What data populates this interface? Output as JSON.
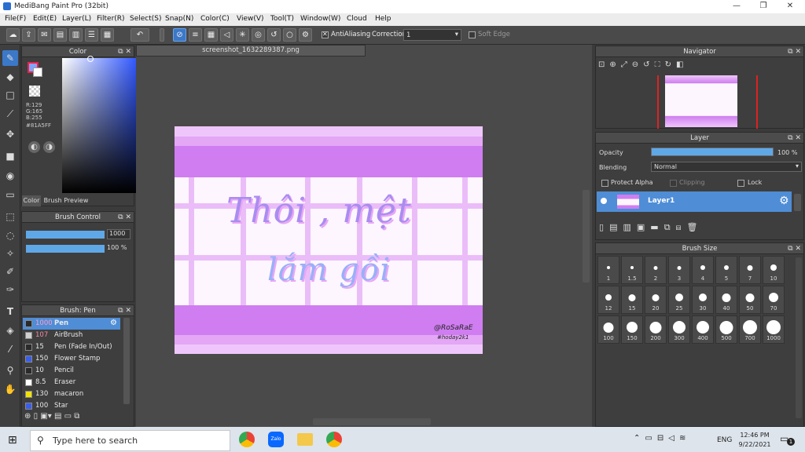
{
  "window": {
    "title": "MediBang Paint Pro (32bit)",
    "minimize": "—",
    "maximize": "❐",
    "close": "✕"
  },
  "menu": [
    "File(F)",
    "Edit(E)",
    "Layer(L)",
    "Filter(R)",
    "Select(S)",
    "Snap(N)",
    "Color(C)",
    "View(V)",
    "Tool(T)",
    "Window(W)",
    "Cloud",
    "Help"
  ],
  "toolbar": {
    "antialiasing_label": "AntiAliasing",
    "correction_label": "Correction",
    "correction_value": "1",
    "soft_edge_label": "Soft Edge"
  },
  "color_panel": {
    "title": "Color",
    "r": "R:129",
    "g": "G:165",
    "b": "B:255",
    "hex": "#81A5FF",
    "tab_color": "Color",
    "tab_brush_preview": "Brush Preview",
    "primary_color": "#81A5FF"
  },
  "brush_control": {
    "title": "Brush Control",
    "size_value": "1000",
    "opacity_value": "100 %"
  },
  "brush_panel": {
    "title": "Brush: Pen",
    "items": [
      {
        "size": "1000",
        "name": "Pen",
        "color": "#2a2a2a",
        "selected": true
      },
      {
        "size": "107",
        "name": "AirBrush",
        "color": "#cfcfcf"
      },
      {
        "size": "15",
        "name": "Pen (Fade In/Out)",
        "color": "#2a2a2a"
      },
      {
        "size": "150",
        "name": "Flower Stamp",
        "color": "#3a5ee8"
      },
      {
        "size": "10",
        "name": "Pencil",
        "color": "#2a2a2a"
      },
      {
        "size": "8.5",
        "name": "Eraser",
        "color": "#ffffff"
      },
      {
        "size": "130",
        "name": "macaron",
        "color": "#f2e200"
      },
      {
        "size": "100",
        "name": "Star",
        "color": "#3a5ee8"
      }
    ]
  },
  "document": {
    "tab": "screenshot_1632289387.png",
    "artwork_line1": "Thôi , mệt",
    "artwork_line2": "lắm gồi",
    "signature": "@RoSaRaE",
    "signature_tag": "#hoday2k1"
  },
  "navigator": {
    "title": "Navigator"
  },
  "layer_panel": {
    "title": "Layer",
    "opacity_label": "Opacity",
    "opacity_value": "100 %",
    "opacity_fraction": 1.0,
    "blending_label": "Blending",
    "blending_value": "Normal",
    "protect_alpha": "Protect Alpha",
    "clipping": "Clipping",
    "lock": "Lock",
    "layers": [
      {
        "name": "Layer1"
      }
    ]
  },
  "brush_size": {
    "title": "Brush Size",
    "sizes": [
      "1",
      "1.5",
      "2",
      "3",
      "4",
      "5",
      "7",
      "10",
      "12",
      "15",
      "20",
      "25",
      "30",
      "40",
      "50",
      "70",
      "100",
      "150",
      "200",
      "300",
      "400",
      "500",
      "700",
      "1000"
    ]
  },
  "taskbar": {
    "search_placeholder": "Type here to search",
    "lang": "ENG",
    "time": "12:46 PM",
    "date": "9/22/2021",
    "notifications": "1"
  },
  "colors": {
    "accent": "#3c78c8",
    "art_purple": "#cf7df0",
    "art_light": "#efc6fb"
  }
}
